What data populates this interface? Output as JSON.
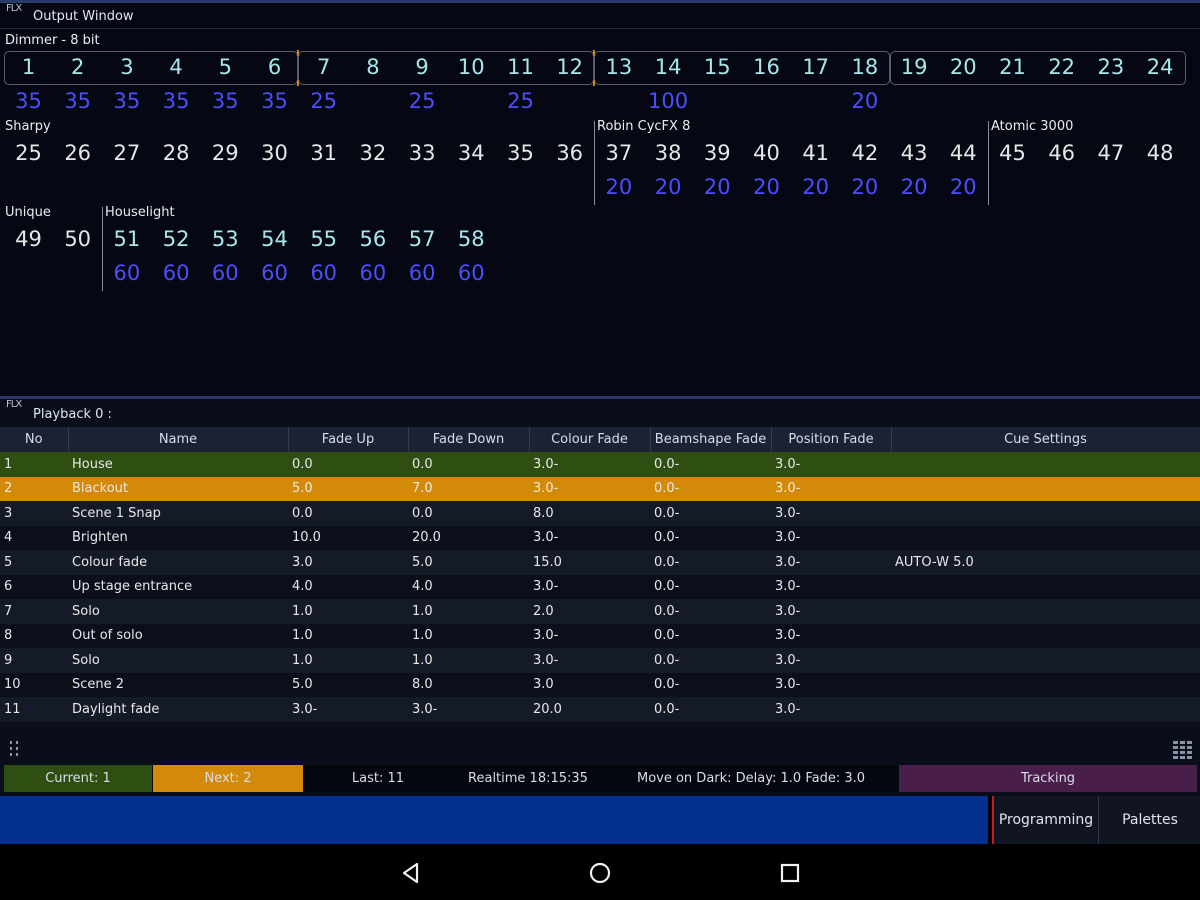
{
  "output": {
    "logo": "FLX",
    "title": "Output Window",
    "dimmer": {
      "label": "Dimmer - 8 bit",
      "channels": [
        "1",
        "2",
        "3",
        "4",
        "5",
        "6",
        "7",
        "8",
        "9",
        "10",
        "11",
        "12",
        "13",
        "14",
        "15",
        "16",
        "17",
        "18",
        "19",
        "20",
        "21",
        "22",
        "23",
        "24"
      ],
      "levels": [
        "35",
        "35",
        "35",
        "35",
        "35",
        "35",
        "25",
        "",
        "25",
        "",
        "25",
        "",
        "",
        "100",
        "",
        "",
        "",
        "20",
        "",
        "",
        "",
        "",
        "",
        ""
      ]
    },
    "sharpy": {
      "label": "Sharpy",
      "channels": [
        "25",
        "26",
        "27",
        "28",
        "29",
        "30",
        "31",
        "32",
        "33",
        "34",
        "35",
        "36"
      ]
    },
    "robin": {
      "label": "Robin CycFX 8",
      "channels": [
        "37",
        "38",
        "39",
        "40",
        "41",
        "42",
        "43",
        "44"
      ],
      "levels": [
        "20",
        "20",
        "20",
        "20",
        "20",
        "20",
        "20",
        "20"
      ]
    },
    "atomic": {
      "label": "Atomic 3000",
      "channels": [
        "45",
        "46",
        "47",
        "48"
      ]
    },
    "unique": {
      "label": "Unique",
      "channels": [
        "49",
        "50"
      ]
    },
    "houselight": {
      "label": "Houselight",
      "channels": [
        "51",
        "52",
        "53",
        "54",
        "55",
        "56",
        "57",
        "58"
      ],
      "levels": [
        "60",
        "60",
        "60",
        "60",
        "60",
        "60",
        "60",
        "60"
      ]
    }
  },
  "playback": {
    "logo": "FLX",
    "title": "Playback 0 :",
    "columns": [
      "No",
      "Name",
      "Fade Up",
      "Fade Down",
      "Colour Fade",
      "Beamshape Fade",
      "Position Fade",
      "Cue Settings"
    ],
    "rows": [
      [
        "1",
        "House",
        "0.0",
        "0.0",
        "3.0-",
        "0.0-",
        "3.0-",
        ""
      ],
      [
        "2",
        "Blackout",
        "5.0",
        "7.0",
        "3.0-",
        "0.0-",
        "3.0-",
        ""
      ],
      [
        "3",
        "Scene 1 Snap",
        "0.0",
        "0.0",
        "8.0",
        "0.0-",
        "3.0-",
        ""
      ],
      [
        "4",
        "Brighten",
        "10.0",
        "20.0",
        "3.0-",
        "0.0-",
        "3.0-",
        ""
      ],
      [
        "5",
        "Colour fade",
        "3.0",
        "5.0",
        "15.0",
        "0.0-",
        "3.0-",
        "AUTO-W 5.0"
      ],
      [
        "6",
        "Up stage entrance",
        "4.0",
        "4.0",
        "3.0-",
        "0.0-",
        "3.0-",
        ""
      ],
      [
        "7",
        "Solo",
        "1.0",
        "1.0",
        "2.0",
        "0.0-",
        "3.0-",
        ""
      ],
      [
        "8",
        "Out of solo",
        "1.0",
        "1.0",
        "3.0-",
        "0.0-",
        "3.0-",
        ""
      ],
      [
        "9",
        "Solo",
        "1.0",
        "1.0",
        "3.0-",
        "0.0-",
        "3.0-",
        ""
      ],
      [
        "10",
        "Scene 2",
        "5.0",
        "8.0",
        "3.0",
        "0.0-",
        "3.0-",
        ""
      ],
      [
        "11",
        "Daylight fade",
        "3.0-",
        "3.0-",
        "20.0",
        "0.0-",
        "3.0-",
        ""
      ]
    ],
    "status": {
      "current": "Current: 1",
      "next": "Next: 2",
      "last": "Last: 11",
      "realtime": "Realtime 18:15:35",
      "move_on_dark": "Move on Dark: Delay: 1.0  Fade: 3.0",
      "mode": "Tracking"
    }
  },
  "buttons": {
    "programming": "Programming",
    "palettes": "Palettes"
  },
  "icons": {
    "nav": [
      "back-icon",
      "home-icon",
      "recents-icon"
    ],
    "table": [
      "reorder-handle-icon",
      "grid-icon"
    ]
  },
  "colors": {
    "current": "#2f4f12",
    "next": "#d28a08",
    "tracking": "#4a1e4a",
    "blue_bar": "#04308f",
    "level": "#4d4dff",
    "channel_cyan": "#a8e6ee"
  }
}
